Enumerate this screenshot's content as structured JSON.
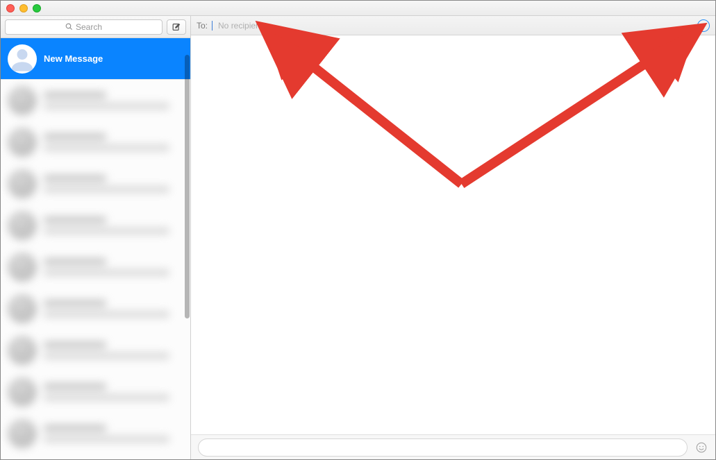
{
  "sidebar": {
    "search_placeholder": "Search",
    "compose_tooltip": "Compose new message",
    "selected_conversation": {
      "title": "New Message"
    }
  },
  "composer": {
    "to_label": "To:",
    "to_placeholder": "No recipients",
    "message_placeholder": ""
  },
  "icons": {
    "add_contact": "+"
  }
}
